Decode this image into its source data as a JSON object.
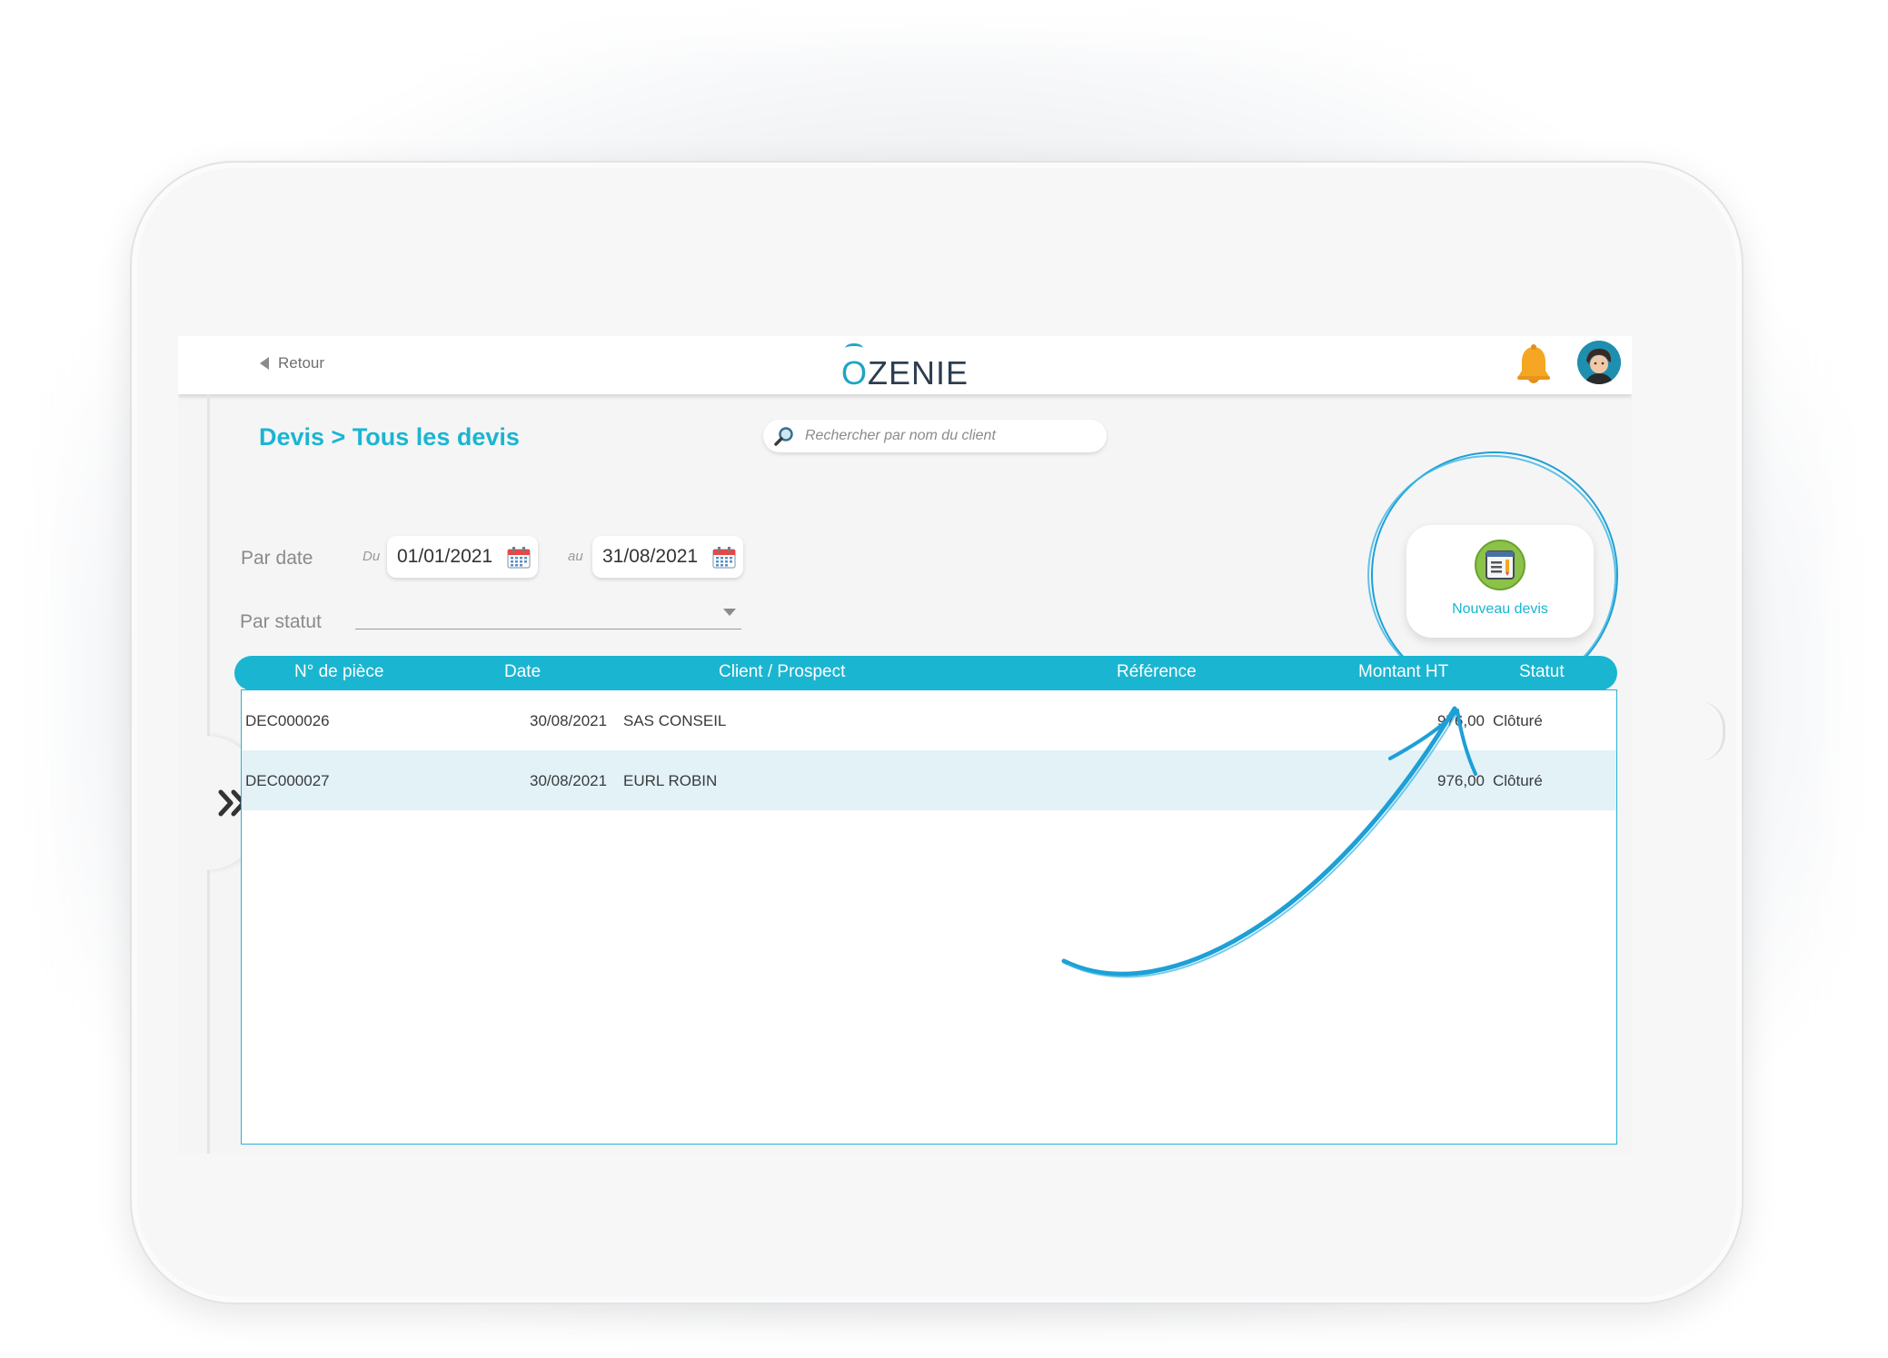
{
  "topbar": {
    "back_label": "Retour",
    "logo_text": "ZENIE",
    "logo_initial": "O",
    "bell_icon": "bell-icon",
    "avatar_icon": "user-avatar"
  },
  "page": {
    "title": "Devis > Tous les devis"
  },
  "search": {
    "placeholder": "Rechercher par nom du client",
    "icon": "search-icon"
  },
  "filters": {
    "by_date_label": "Par date",
    "from_label": "Du",
    "from_value": "01/01/2021",
    "to_label": "au",
    "to_value": "31/08/2021",
    "by_status_label": "Par statut",
    "status_value": ""
  },
  "new_quote": {
    "label": "Nouveau devis",
    "icon": "document-icon"
  },
  "table": {
    "columns": [
      "N° de pièce",
      "Date",
      "Client / Prospect",
      "Référence",
      "Montant HT",
      "Statut"
    ],
    "rows": [
      {
        "number": "DEC000026",
        "date": "30/08/2021",
        "client": "SAS CONSEIL",
        "reference": "",
        "amount": "976,00",
        "status": "Clôturé"
      },
      {
        "number": "DEC000027",
        "date": "30/08/2021",
        "client": "EURL ROBIN",
        "reference": "",
        "amount": "976,00",
        "status": "Clôturé"
      }
    ]
  },
  "colors": {
    "accent": "#1ab5d1",
    "annotation": "#1ea0d6",
    "bell": "#f5a623"
  }
}
